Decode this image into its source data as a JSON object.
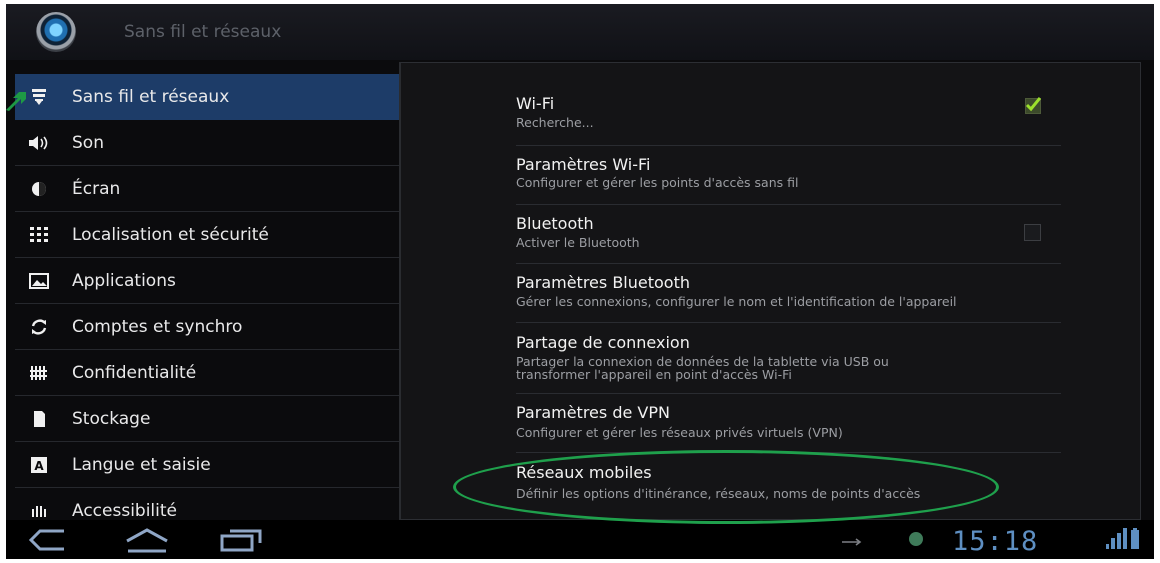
{
  "action_bar": {
    "title": "Sans fil et réseaux"
  },
  "sidebar": {
    "items": [
      {
        "label": "Sans fil et réseaux",
        "icon": "wireless-icon",
        "active": true
      },
      {
        "label": "Son",
        "icon": "speaker-icon"
      },
      {
        "label": "Écran",
        "icon": "brightness-icon"
      },
      {
        "label": "Localisation et sécurité",
        "icon": "location-grid-icon"
      },
      {
        "label": "Applications",
        "icon": "applications-icon"
      },
      {
        "label": "Comptes et synchro",
        "icon": "sync-icon"
      },
      {
        "label": "Confidentialité",
        "icon": "privacy-icon"
      },
      {
        "label": "Stockage",
        "icon": "storage-icon"
      },
      {
        "label": "Langue et saisie",
        "icon": "language-icon"
      },
      {
        "label": "Accessibilité",
        "icon": "accessibility-icon"
      }
    ]
  },
  "settings": {
    "wifi": {
      "title": "Wi-Fi",
      "summary": "Recherche...",
      "checked": true
    },
    "wifi_params": {
      "title": "Paramètres Wi-Fi",
      "summary": "Configurer et gérer les points d'accès sans fil"
    },
    "bluetooth": {
      "title": "Bluetooth",
      "summary": "Activer le Bluetooth",
      "checked": false
    },
    "bluetooth_params": {
      "title": "Paramètres Bluetooth",
      "summary": "Gérer les connexions, configurer le nom et l'identification de l'appareil"
    },
    "tethering": {
      "title": "Partage de connexion",
      "summary_line1": "Partager la connexion de données de la tablette via USB ou",
      "summary_line2": "transformer l'appareil en point d'accès Wi-Fi"
    },
    "vpn": {
      "title": "Paramètres de VPN",
      "summary": "Configurer et gérer les réseaux privés virtuels (VPN)"
    },
    "mobile": {
      "title": "Réseaux mobiles",
      "summary": "Définir les options d'itinérance, réseaux, noms de points d'accès"
    }
  },
  "status_bar": {
    "time": "15:18"
  },
  "colors": {
    "accent": "#1d3c68",
    "highlight_oval": "#1fa04c",
    "clock": "#5e8fc2"
  }
}
